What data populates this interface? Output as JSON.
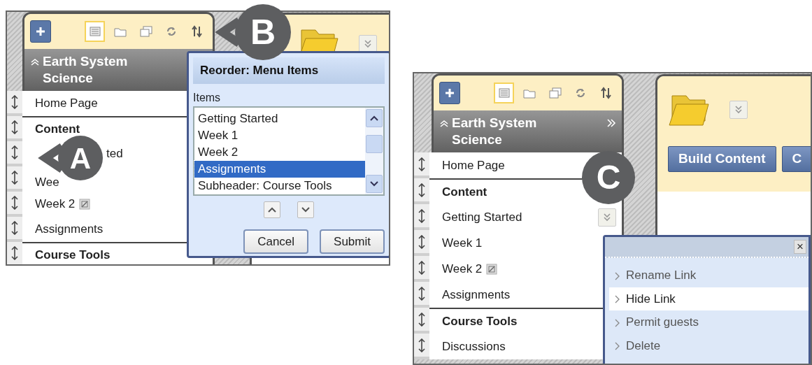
{
  "screens": [
    {
      "course_title": "Earth System Science",
      "header_menu_button": false,
      "menu": [
        {
          "kind": "link",
          "label": "Home Page",
          "hidden": false,
          "expanded": false
        },
        {
          "kind": "header",
          "label": "Content",
          "hidden": false,
          "expanded": false
        },
        {
          "kind": "tail",
          "label": "ted",
          "hidden": false,
          "expanded": false
        },
        {
          "kind": "link",
          "label": "Wee",
          "hidden": false,
          "expanded": false
        },
        {
          "kind": "link",
          "label": "Week 2",
          "hidden": true,
          "expanded": false
        },
        {
          "kind": "link",
          "label": "Assignments",
          "hidden": false,
          "expanded": false
        },
        {
          "kind": "header",
          "label": "Course Tools",
          "hidden": false,
          "expanded": false
        }
      ],
      "reorder_dialog": {
        "title": "Reorder: Menu Items",
        "list_label": "Items",
        "items": [
          {
            "label": "Getting Started",
            "selected": false
          },
          {
            "label": "Week 1",
            "selected": false
          },
          {
            "label": "Week 2",
            "selected": false
          },
          {
            "label": "Assignments",
            "selected": true
          },
          {
            "label": "Subheader: Course Tools",
            "selected": false
          }
        ],
        "buttons": [
          "Cancel",
          "Submit"
        ]
      },
      "callouts": [
        "A",
        "B"
      ]
    },
    {
      "course_title": "Earth System Science",
      "header_menu_button": true,
      "menu": [
        {
          "kind": "link",
          "label": "Home Page",
          "hidden": false,
          "expanded": false
        },
        {
          "kind": "header",
          "label": "Content",
          "hidden": false,
          "expanded": false
        },
        {
          "kind": "link",
          "label": "Getting Started",
          "hidden": false,
          "expanded": true
        },
        {
          "kind": "link",
          "label": "Week 1",
          "hidden": false,
          "expanded": false
        },
        {
          "kind": "link",
          "label": "Week 2",
          "hidden": true,
          "expanded": false
        },
        {
          "kind": "link",
          "label": "Assignments",
          "hidden": false,
          "expanded": false
        },
        {
          "kind": "header",
          "label": "Course Tools",
          "hidden": false,
          "expanded": false
        },
        {
          "kind": "link",
          "label": "Discussions",
          "hidden": false,
          "expanded": false
        }
      ],
      "content_buttons": [
        "Build Content",
        "C"
      ],
      "context_menu": {
        "close": "×",
        "items": [
          {
            "label": "Rename Link",
            "selected": false
          },
          {
            "label": "Hide Link",
            "selected": true
          },
          {
            "label": "Permit guests",
            "selected": false
          },
          {
            "label": "Delete",
            "selected": false
          }
        ]
      },
      "callouts": [
        "C"
      ]
    }
  ]
}
